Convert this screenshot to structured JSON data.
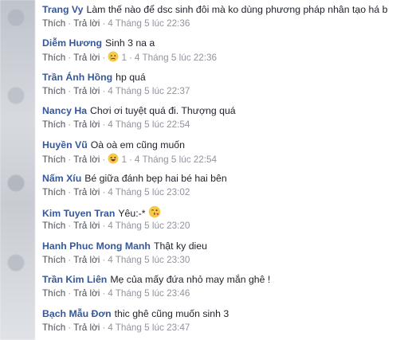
{
  "like_label": "Thích",
  "reply_label": "Trả lời",
  "separator": "·",
  "comments": [
    {
      "author": "Trang Vy",
      "text": "Làm thế nào để dsc sinh đôi mà ko dùng phương pháp nhân tạo há b",
      "time": "4 Tháng 5 lúc 22:36"
    },
    {
      "author": "Diễm Hương",
      "text": "Sinh 3 na a",
      "reaction_icon": "sad-face-icon",
      "reaction_count": "1",
      "time": "4 Tháng 5 lúc 22:36"
    },
    {
      "author": "Trần Ánh Hồng",
      "text": "hp quá",
      "time": "4 Tháng 5 lúc 22:37"
    },
    {
      "author": "Nancy Ha",
      "text": "Chơi ơi tuyệt quá đi. Thượng quá",
      "time": "4 Tháng 5 lúc 22:54"
    },
    {
      "author": "Huyền Vũ",
      "text": "Oà oà em cũng muốn",
      "reaction_icon": "haha-face-icon",
      "reaction_count": "1",
      "time": "4 Tháng 5 lúc 22:54"
    },
    {
      "author": "Nấm Xíu",
      "text": "Bé giữa đánh bẹp hai bé hai bên",
      "time": "4 Tháng 5 lúc 23:02"
    },
    {
      "author": "Kim Tuyen Tran",
      "text": "Yêu:-*",
      "emoji_icon": "kiss-face-icon",
      "time": "4 Tháng 5 lúc 23:20"
    },
    {
      "author": "Hanh Phuc Mong Manh",
      "text": "Thật ky dieu",
      "time": "4 Tháng 5 lúc 23:30"
    },
    {
      "author": "Trần Kim Liên",
      "text": "Mẹ của mấy đứa nhỏ may mắn ghê !",
      "time": "4 Tháng 5 lúc 23:46"
    },
    {
      "author": "Bạch Mẫu Đơn",
      "text": "thic ghê cũng muốn sinh 3",
      "time": "4 Tháng 5 lúc 23:47"
    }
  ]
}
